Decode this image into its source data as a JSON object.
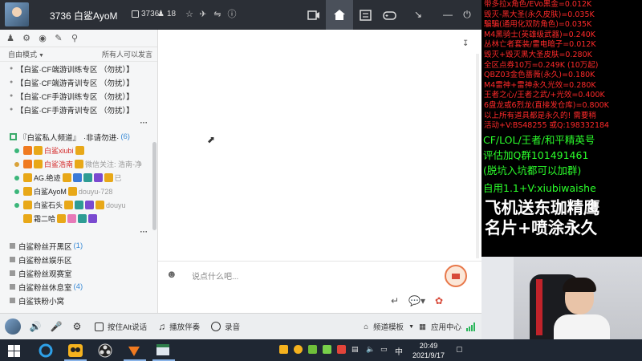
{
  "titlebar": {
    "title": "3736 白鲨AyoM",
    "room_id": "3736",
    "followers": "18",
    "nav": [
      "video-icon",
      "home-icon",
      "list-icon",
      "gamepad-icon"
    ],
    "window_controls": [
      "tray-icon",
      "minimize-icon",
      "power-icon"
    ]
  },
  "leftpanel": {
    "mode_label": "自由模式",
    "mode_hint": "所有人可以发言",
    "channels_top": [
      "【白鲨·CF端游训练专区 （勿扰）】",
      "【白鲨·CF端游青训专区 （勿扰）】",
      "【白鲨·CF手游训练专区 （勿扰）】",
      "【白鲨·CF手游青训专区 （勿扰）】"
    ],
    "private_channel": {
      "label": "『白鲨私人频道』",
      "note": "·非请勿进·",
      "count": "(6)"
    },
    "users": [
      {
        "name": "白鲨xiubi",
        "extra": "",
        "dot": "#3bb67a",
        "red": true
      },
      {
        "name": "白鲨浩南",
        "extra": "微信关注: 浩南-净",
        "dot": "#d9a23a",
        "red": true
      },
      {
        "name": "AG.绝迹",
        "extra": "已",
        "dot": "#3bb67a",
        "red": false
      },
      {
        "name": "白鲨AyoM",
        "extra": "douyu-728",
        "dot": "#3bb67a",
        "red": false
      },
      {
        "name": "白鲨石头",
        "extra": "douyu",
        "dot": "#3bb67a",
        "red": false
      },
      {
        "name": "霜二哈",
        "extra": "",
        "dot": "",
        "red": false
      }
    ],
    "groups": [
      {
        "label": "白鲨粉丝开黑区",
        "count": "(1)"
      },
      {
        "label": "白鲨粉丝娱乐区",
        "count": ""
      },
      {
        "label": "白鲨粉丝观赛室",
        "count": ""
      },
      {
        "label": "白鲨粉丝休息室",
        "count": "(4)"
      },
      {
        "label": "白鲨铁粉小窝",
        "count": ""
      }
    ]
  },
  "chat": {
    "placeholder": "说点什么吧..."
  },
  "toolbar": {
    "push_to_talk": "按住Alt说话",
    "music": "播放伴奏",
    "record": "录音",
    "template": "频道模板",
    "app_center": "应用中心"
  },
  "taskbar": {
    "time": "20:49",
    "date": "2021/9/17",
    "ime": "中"
  },
  "overlay": {
    "red_lines": [
      "带多拉x角色/EVo黑金=0.012K",
      "毁灭-黑大圣(永久皮肤)=0.035K",
      "騙騙(通用化双防角色)=0.035K",
      "M4黑骑士(英雄级武器)=0.240K",
      "丛林亡者套装/雷电暗子=0.012K",
      "毁灭+毁灭黑大圣皮肤=0.280K",
      "全区点券10万=0.249K (10万起)",
      "QBZ03金色蔷薇(永久)=0.180K",
      "M4雷神+雷神永久光效=0.280K",
      "王者之心/王者之武/+光效=0.400K",
      "6盘龙或6烈龙(直接发仓库)=0.800K",
      "以上所有道具都是永久的! 需要稍",
      "活动+V:BS48255  或Q:198332184"
    ],
    "green_lines_1": [
      "CF/LOL/王者/和平精英号",
      "评估加Q群101491461",
      "(脱坑入坑都可以加群)"
    ],
    "green_line_2": "自用1.1+V:xiubiwaishe",
    "white_lines": [
      "飞机送东珈精鹰",
      "名片+喷涂永久"
    ]
  }
}
